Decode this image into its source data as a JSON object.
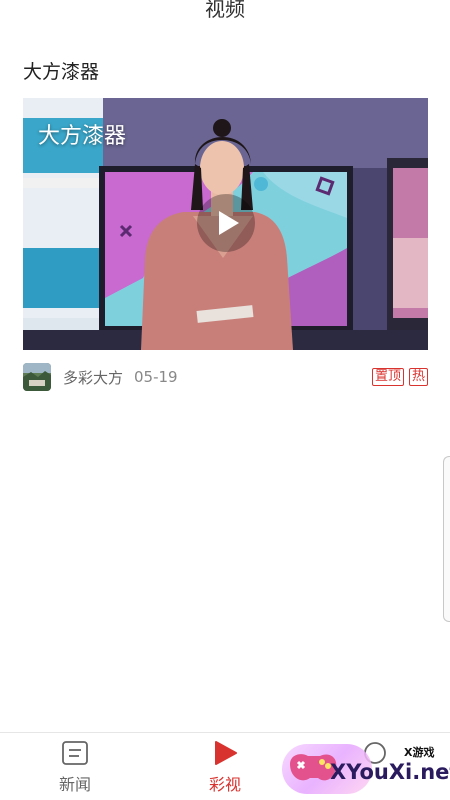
{
  "header": {
    "title": "视频"
  },
  "article": {
    "title": "大方漆器",
    "video": {
      "overlay_title": "大方漆器",
      "play_icon": "play-icon"
    },
    "source": "多彩大方",
    "date": "05-19",
    "tags": [
      "置顶",
      "热"
    ]
  },
  "tabbar": {
    "items": [
      {
        "label": "新闻",
        "icon": "news-icon",
        "active": false
      },
      {
        "label": "彩视",
        "icon": "video-play-icon",
        "active": true
      },
      {
        "label": "",
        "icon": "more-icon",
        "active": false
      }
    ]
  },
  "watermark": {
    "small": "X游戏",
    "big": "XYouXi.net"
  },
  "colors": {
    "accent": "#d9332f",
    "text": "#222222",
    "muted": "#888888"
  }
}
